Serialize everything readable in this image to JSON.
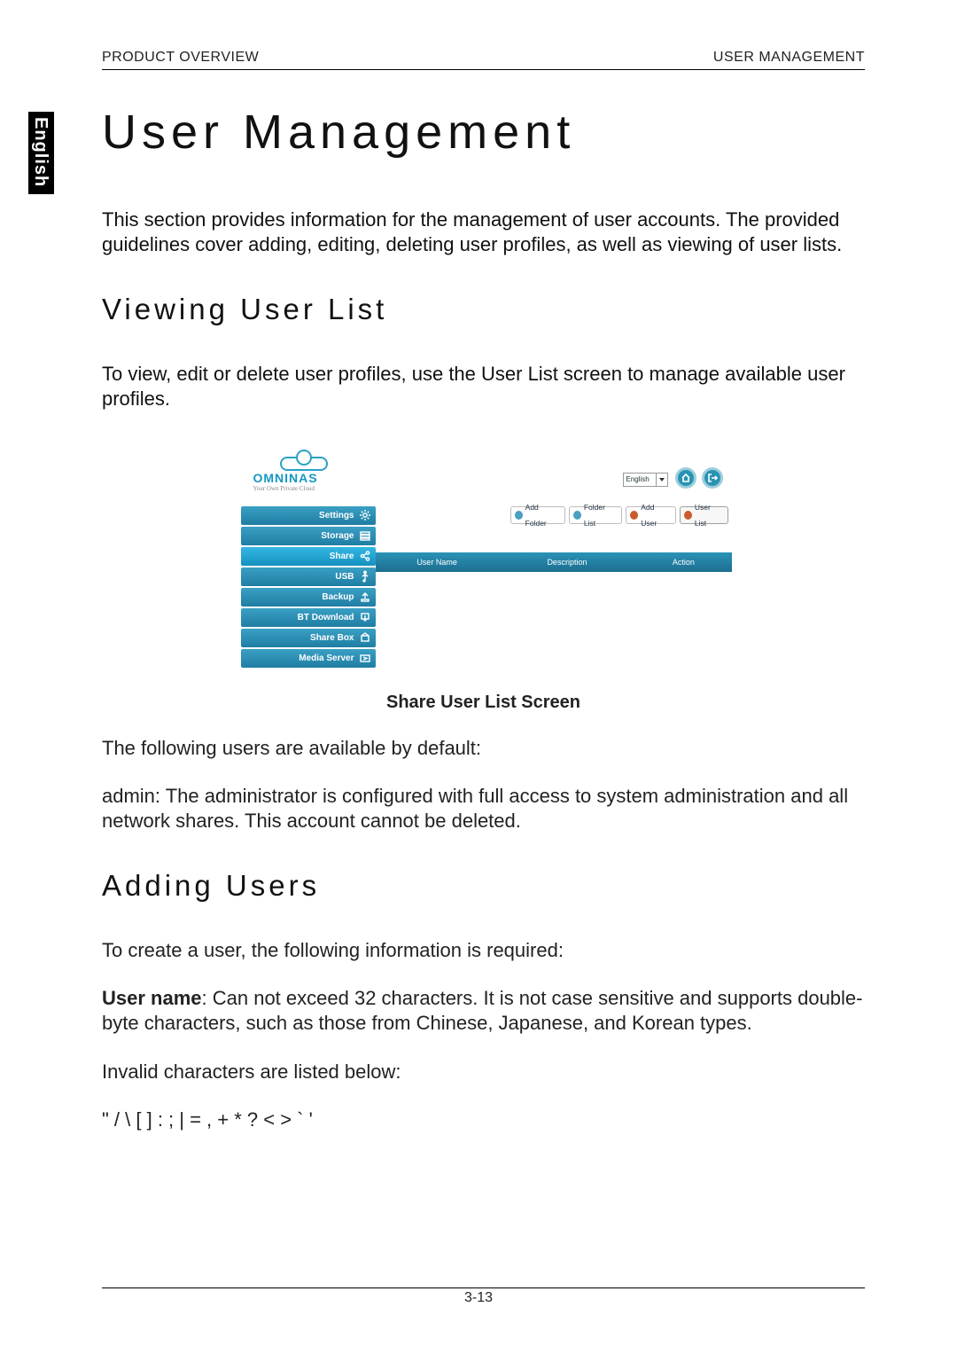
{
  "header": {
    "left": "PRODUCT OVERVIEW",
    "right": "USER MANAGEMENT"
  },
  "side_tab": "English",
  "title": "User Management",
  "intro": "This section provides information for the management of user accounts. The provided guidelines cover adding, editing, deleting user profiles, as well as viewing of user lists.",
  "sec1_title": "Viewing User List",
  "sec1_p1": "To view, edit or delete user profiles, use the User List screen to manage available user profiles.",
  "shot": {
    "brand": "OMNINAS",
    "tagline": "Your Own Private Cloud",
    "language": "English",
    "home_icon": "home-icon",
    "exit_icon": "logout-icon",
    "toolbar": [
      {
        "label": "Add Folder",
        "icon": "folder"
      },
      {
        "label": "Folder List",
        "icon": "folder"
      },
      {
        "label": "Add User",
        "icon": "user"
      },
      {
        "label": "User List",
        "icon": "user"
      }
    ],
    "nav": [
      {
        "label": "Settings",
        "icon": "gear"
      },
      {
        "label": "Storage",
        "icon": "disks"
      },
      {
        "label": "Share",
        "icon": "share"
      },
      {
        "label": "USB",
        "icon": "usb"
      },
      {
        "label": "Backup",
        "icon": "backup"
      },
      {
        "label": "BT Download",
        "icon": "bt"
      },
      {
        "label": "Share Box",
        "icon": "box"
      },
      {
        "label": "Media Server",
        "icon": "media"
      }
    ],
    "columns": [
      "User Name",
      "Description",
      "Action"
    ]
  },
  "caption": "Share User List Screen",
  "sec1_p2": "The following users are available by default:",
  "sec1_li": "admin: The administrator is configured with full access to system administration and all network shares. This account cannot be deleted.",
  "sec2_title": "Adding Users",
  "sec2_p1": "To create a user, the following information is required:",
  "sec2_user_label": "User name",
  "sec2_user_text": ": Can not exceed 32 characters. It is not case sensitive and supports double-byte characters, such as those from Chinese, Japanese, and Korean types.",
  "sec2_invalid_lead": "Invalid characters are listed below:",
  "sec2_invalid_chars": "\" / \\ [ ] : ; | = , + * ? < > ` '",
  "page_number": "3-13"
}
